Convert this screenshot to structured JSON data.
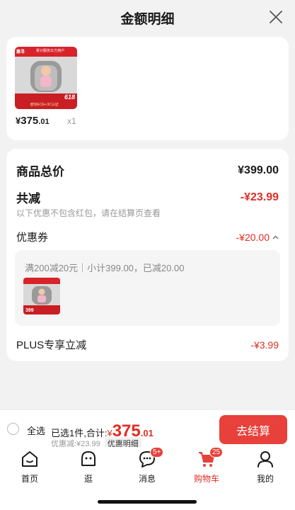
{
  "header": {
    "title": "金额明细"
  },
  "product": {
    "thumb_brand": "惠寻",
    "thumb_banner": "累计服务11万用户",
    "thumb_promo": "618",
    "thumb_footer": "欧标ECE+3C认证",
    "price_yen": "¥",
    "price_int": "375",
    "price_dec": ".01",
    "quantity": "x1"
  },
  "breakdown": {
    "total_label": "商品总价",
    "total_value": "¥399.00",
    "reduce_label": "共减",
    "reduce_value": "-¥23.99",
    "note": "以下优惠不包含红包，请在结算页查看",
    "coupon_label": "优惠券",
    "coupon_value": "-¥20.00",
    "coupon_desc": "满200减20元｜小计399.00，已减20.00",
    "coupon_thumb_price": "399",
    "plus_label": "PLUS专享立减",
    "plus_value": "-¥3.99"
  },
  "checkout": {
    "select_all": "全选",
    "selected_prefix": "已选1件,合计:",
    "yen": "¥",
    "total_int": "375",
    "total_dec": ".01",
    "discount_text": "优惠减:¥23.99",
    "detail_tag": "优惠明细",
    "button": "去结算"
  },
  "tabbar": {
    "items": [
      {
        "label": "首页",
        "icon": "home-icon"
      },
      {
        "label": "逛",
        "icon": "browse-icon"
      },
      {
        "label": "消息",
        "icon": "message-icon",
        "badge": "5+"
      },
      {
        "label": "购物车",
        "icon": "cart-icon",
        "badge": "25",
        "active": true
      },
      {
        "label": "我的",
        "icon": "profile-icon"
      }
    ]
  },
  "colors": {
    "accent": "#e02e24",
    "button": "#e8403a",
    "background": "#f2f2f2"
  }
}
